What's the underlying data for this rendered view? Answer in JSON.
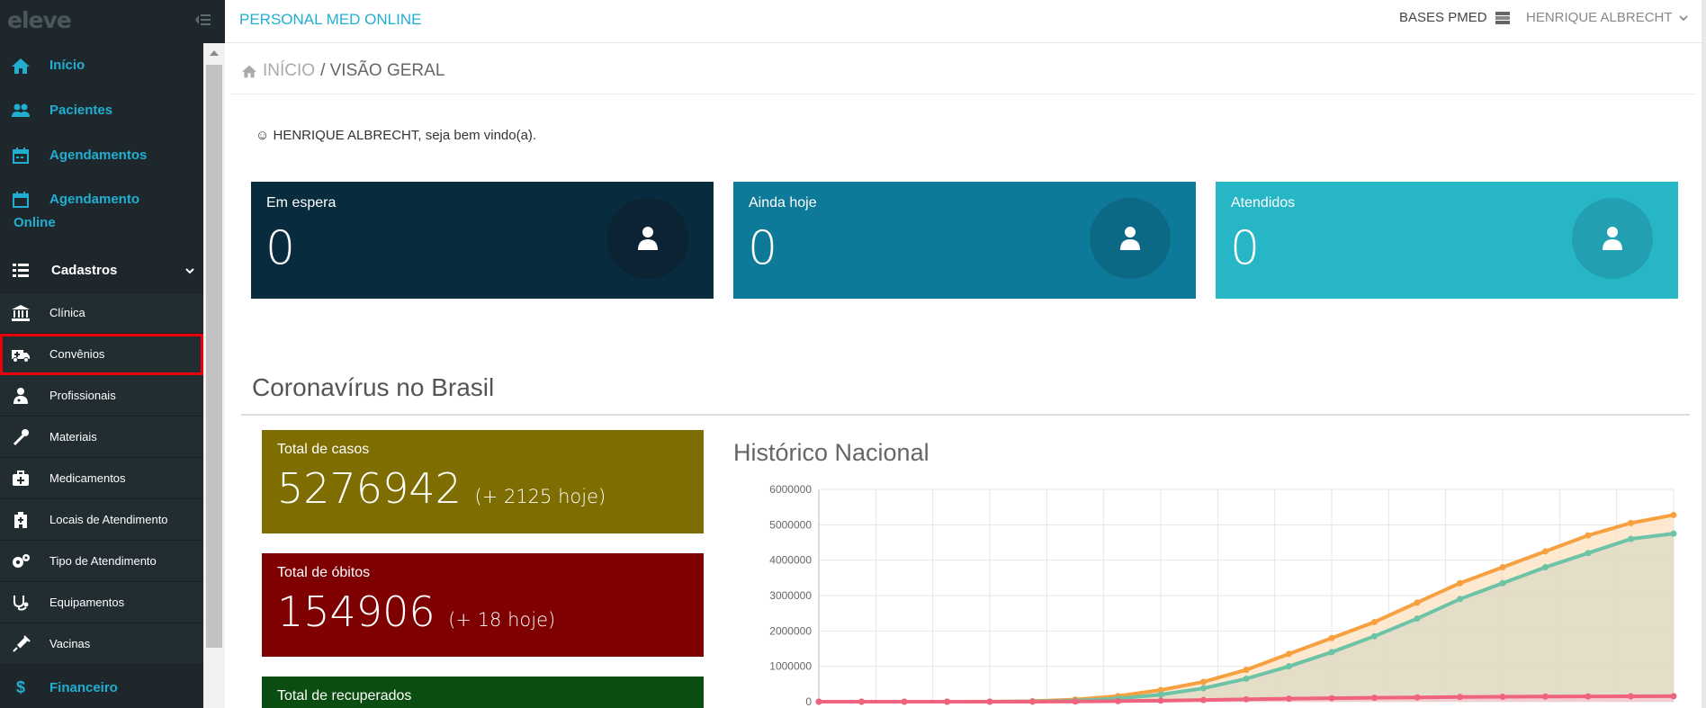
{
  "sidebar": {
    "logo": "eleve",
    "items": [
      {
        "label": "Início",
        "icon": "home-icon"
      },
      {
        "label": "Pacientes",
        "icon": "users-icon"
      },
      {
        "label": "Agendamentos",
        "icon": "calendar-icon"
      },
      {
        "label": "Agendamento",
        "label2": "Online",
        "icon": "calendar-icon"
      },
      {
        "label": "Cadastros",
        "icon": "list-icon"
      },
      {
        "label": "Clínica",
        "icon": "bank-icon"
      },
      {
        "label": "Convênios",
        "icon": "ambulance-icon"
      },
      {
        "label": "Profissionais",
        "icon": "user-md-icon"
      },
      {
        "label": "Materiais",
        "icon": "eyedropper-icon"
      },
      {
        "label": "Medicamentos",
        "icon": "medkit-icon"
      },
      {
        "label": "Locais de Atendimento",
        "icon": "hospital-icon"
      },
      {
        "label": "Tipo de Atendimento",
        "icon": "cogs-icon"
      },
      {
        "label": "Equipamentos",
        "icon": "stethoscope-icon"
      },
      {
        "label": "Vacinas",
        "icon": "syringe-icon"
      },
      {
        "label": "Financeiro",
        "icon": "dollar-icon"
      }
    ]
  },
  "header": {
    "brand": "PERSONAL MED ONLINE",
    "bases": "BASES PMED",
    "user": "HENRIQUE ALBRECHT"
  },
  "breadcrumb": {
    "home": "INÍCIO",
    "current": "/ VISÃO GERAL"
  },
  "welcome": "HENRIQUE ALBRECHT, seja bem vindo(a).",
  "cards": [
    {
      "title": "Em espera",
      "value": "0",
      "color": "#082b3e",
      "circle": "#0b2333"
    },
    {
      "title": "Ainda hoje",
      "value": "0",
      "color": "#0e7a99",
      "circle": "#0c6985"
    },
    {
      "title": "Atendidos",
      "value": "0",
      "color": "#27b6c6",
      "circle": "#229fb0"
    }
  ],
  "covid": {
    "title": "Coronavírus no Brasil",
    "stats": [
      {
        "title": "Total de casos",
        "value": "5276942",
        "delta": "(+ 2125 hoje)",
        "color": "#7e6d00"
      },
      {
        "title": "Total de óbitos",
        "value": "154906",
        "delta": "(+ 18 hoje)",
        "color": "#7e0000"
      },
      {
        "title": "Total de recuperados",
        "value": "",
        "delta": "",
        "color": "#0b4d10"
      }
    ],
    "chart_title": "Histórico Nacional"
  },
  "chart_data": {
    "type": "line",
    "title": "Histórico Nacional",
    "ylim": [
      0,
      6000000
    ],
    "yticks": [
      0,
      1000000,
      2000000,
      3000000,
      4000000,
      5000000,
      6000000
    ],
    "ytick_labels": [
      "0",
      "1000000",
      "2000000",
      "3000000",
      "4000000",
      "5000000",
      "6000000"
    ],
    "grid": true,
    "x": [
      0,
      5,
      10,
      15,
      20,
      25,
      30,
      35,
      40,
      45,
      50,
      55,
      60,
      65,
      70,
      75,
      80,
      85,
      90,
      95,
      100
    ],
    "series": [
      {
        "color": "#f7a040",
        "values": [
          0,
          0,
          0,
          0,
          2000,
          15000,
          60000,
          160000,
          330000,
          560000,
          900000,
          1350000,
          1800000,
          2250000,
          2800000,
          3350000,
          3800000,
          4250000,
          4700000,
          5050000,
          5276942
        ]
      },
      {
        "color": "#6cc3a6",
        "values": [
          0,
          0,
          0,
          0,
          500,
          6000,
          30000,
          90000,
          200000,
          380000,
          650000,
          1000000,
          1400000,
          1850000,
          2350000,
          2900000,
          3350000,
          3800000,
          4200000,
          4600000,
          4750000
        ]
      },
      {
        "color": "#f0637f",
        "values": [
          0,
          0,
          0,
          0,
          100,
          1500,
          6000,
          16000,
          30000,
          48000,
          68000,
          85000,
          100000,
          112000,
          122000,
          132000,
          140000,
          146000,
          150000,
          153000,
          154906
        ]
      }
    ]
  }
}
